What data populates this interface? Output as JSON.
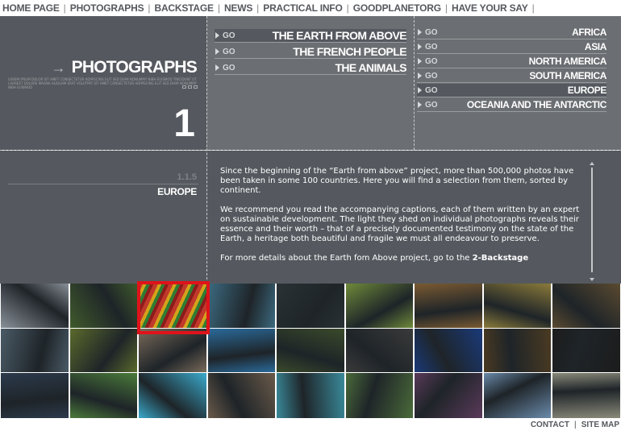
{
  "nav": {
    "items": [
      "HOME PAGE",
      "PHOTOGRAPHS",
      "BACKSTAGE",
      "NEWS",
      "PRACTICAL INFO",
      "GOODPLANETORG",
      "HAVE YOUR SAY"
    ],
    "separator": "|"
  },
  "title_block": {
    "title": "PHOTOGRAPHS",
    "arrow_icon": "right-arrow-icon",
    "micro_text": "LOREM IPSUM DOLOR SIT AMET CONSECTETUR ADIPISCING ELIT SED DIAM NONUMMY NIBH EUISMOD TINCIDUNT UT LAOREET DOLORE MAGNA ALIQUAM ERAT VOLUTPAT SIT AMET CONSECTETUR ADIPISCING ELIT SED DIAM NONUMMY NIBH EUISMOD",
    "number": "1"
  },
  "submenu": {
    "go_label": "GO",
    "items": [
      {
        "label": "THE EARTH FROM ABOVE",
        "active": true
      },
      {
        "label": "THE FRENCH PEOPLE",
        "active": false
      },
      {
        "label": "THE ANIMALS",
        "active": false
      }
    ]
  },
  "continents": {
    "go_label": "GO",
    "items": [
      {
        "label": "AFRICA",
        "active": false
      },
      {
        "label": "ASIA",
        "active": false
      },
      {
        "label": "NORTH AMERICA",
        "active": false
      },
      {
        "label": "SOUTH AMERICA",
        "active": false
      },
      {
        "label": "EUROPE",
        "active": true
      },
      {
        "label": "OCEANIA AND THE ANTARCTIC",
        "active": false
      }
    ]
  },
  "section": {
    "number": "1.1.5",
    "name": "EUROPE"
  },
  "text": {
    "p1": "Since the beginning of the “Earth from above” project, more than 500,000 photos have been taken in some 100 countries. Here you will find a selection from them, sorted by continent.",
    "p2": "We recommend you read the accompanying captions, each of them written by an expert on sustainable development. The light they shed on individual photographs reveals their essence and their worth – that of a precisely documented testimony on the state of the Earth, a heritage both beautiful and fragile we must all endeavour to preserve.",
    "p3_prefix": "For more details about the Earth fom Above project, go to the ",
    "p3_link": "2-Backstage"
  },
  "thumbnails": {
    "selected_index": 2,
    "colors": [
      [
        "#8a9098",
        "#3f5a2c",
        "#8a3a1c",
        "#3c6a80",
        "#2a3236",
        "#6e8a3a",
        "#7a5a32",
        "#8a7a3a",
        "#5a4a30"
      ],
      [
        "#4a5a66",
        "#5a6a2c",
        "#7a6a5a",
        "#2a6a9a",
        "#3a4a2a",
        "#3a3a3a",
        "#1a3a7a",
        "#4a3a22",
        "#1c1c1c"
      ],
      [
        "#2c3a4c",
        "#4a7a3a",
        "#3aaacc",
        "#6a5a4a",
        "#3a8a9a",
        "#4a6a3a",
        "#5a3a5a",
        "#6a8aaa",
        "#8a8a7a"
      ]
    ],
    "accent": "#e0131a"
  },
  "footer": {
    "contact": "CONTACT",
    "sitemap": "SITE MAP",
    "separator": "|"
  }
}
